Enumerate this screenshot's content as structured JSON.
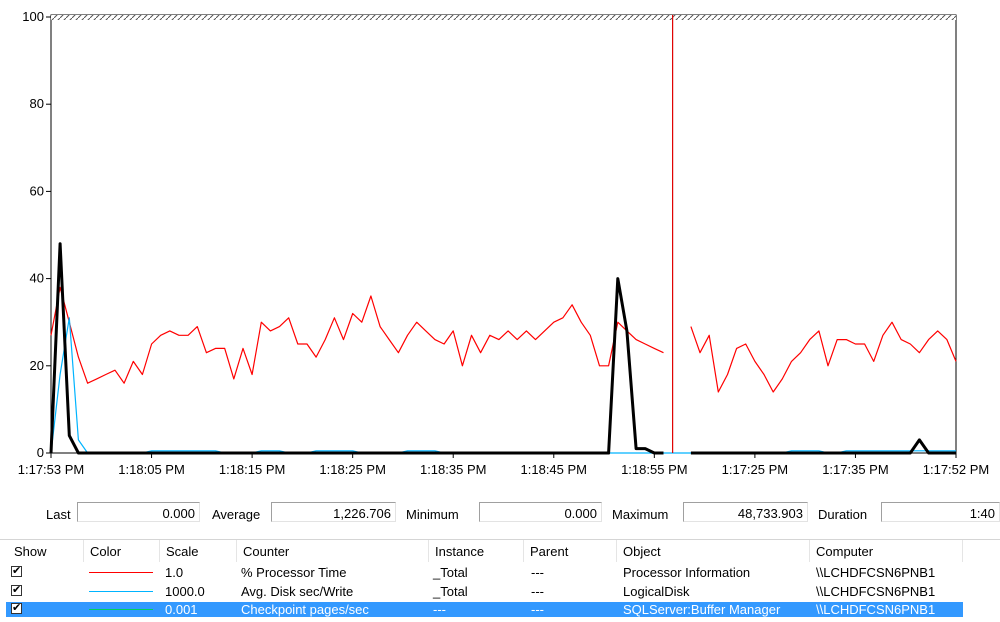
{
  "chart_data": {
    "type": "line",
    "ylim": [
      0,
      100
    ],
    "yticks": [
      "0",
      "20",
      "40",
      "60",
      "80",
      "100"
    ],
    "xticks": [
      "1:17:53 PM",
      "1:18:05 PM",
      "1:18:15 PM",
      "1:18:25 PM",
      "1:18:35 PM",
      "1:18:45 PM",
      "1:18:55 PM",
      "1:17:25 PM",
      "1:17:35 PM",
      "1:17:52 PM"
    ],
    "sample_count": 100,
    "current_sample": 68,
    "colors": {
      "cursor": "#e00000"
    },
    "series": [
      {
        "color": "#ff0000",
        "values": [
          27,
          38,
          30,
          22,
          16,
          17,
          18,
          19,
          16,
          21,
          18,
          25,
          27,
          28,
          27,
          27,
          29,
          23,
          24,
          24,
          17,
          24,
          18,
          30,
          28,
          29,
          31,
          25,
          25,
          22,
          26,
          31,
          26,
          32,
          30,
          36,
          29,
          26,
          23,
          27,
          30,
          28,
          26,
          25,
          28,
          20,
          27,
          23,
          27,
          26,
          28,
          26,
          28,
          26,
          28,
          30,
          31,
          34,
          30,
          27,
          20,
          20,
          30,
          28,
          26,
          25,
          24,
          23,
          null,
          null,
          29,
          23,
          27,
          14,
          18,
          24,
          25,
          21,
          18,
          14,
          17,
          21,
          23,
          26,
          28,
          20,
          26,
          26,
          25,
          25,
          21,
          27,
          30,
          26,
          25,
          23,
          26,
          28,
          26,
          21
        ]
      },
      {
        "color": "#00b4ff",
        "values": [
          0,
          18,
          31,
          3,
          0,
          0,
          0,
          0,
          0,
          0,
          0,
          0.5,
          0.5,
          0.5,
          0.5,
          0.5,
          0.5,
          0.5,
          0.5,
          0,
          0,
          0,
          0,
          0.5,
          0.5,
          0.5,
          0,
          0,
          0,
          0.5,
          0.5,
          0.5,
          0.5,
          0.5,
          0,
          0,
          0,
          0,
          0,
          0.5,
          0.5,
          0.5,
          0.5,
          0,
          0,
          0,
          0,
          0,
          0,
          0,
          0,
          0,
          0,
          0,
          0,
          0,
          0,
          0,
          0,
          0,
          0,
          0,
          0,
          0,
          0,
          0,
          0,
          0,
          0,
          0,
          0,
          0,
          0,
          0,
          0,
          0,
          0,
          0,
          0,
          0,
          0,
          0.5,
          0.5,
          0.5,
          0.5,
          0,
          0,
          0.5,
          0.5,
          0.5,
          0.5,
          0.5,
          0.5,
          0.5,
          0.5,
          0.5,
          0.5,
          0.5,
          0.5,
          0.5
        ]
      },
      {
        "color": "#000000",
        "values": [
          0,
          48,
          4,
          0,
          0,
          0,
          0,
          0,
          0,
          0,
          0,
          0,
          0,
          0,
          0,
          0,
          0,
          0,
          0,
          0,
          0,
          0,
          0,
          0,
          0,
          0,
          0,
          0,
          0,
          0,
          0,
          0,
          0,
          0,
          0,
          0,
          0,
          0,
          0,
          0,
          0,
          0,
          0,
          0,
          0,
          0,
          0,
          0,
          0,
          0,
          0,
          0,
          0,
          0,
          0,
          0,
          0,
          0,
          0,
          0,
          0,
          0,
          40,
          28,
          1,
          1,
          0,
          0,
          null,
          null,
          0,
          0,
          0,
          0,
          0,
          0,
          0,
          0,
          0,
          0,
          0,
          0,
          0,
          0,
          0,
          0,
          0,
          0,
          0,
          0,
          0,
          0,
          0,
          0,
          0,
          3,
          0,
          0,
          0,
          0
        ]
      }
    ]
  },
  "stats": {
    "last_label": "Last",
    "last_value": "0.000",
    "average_label": "Average",
    "average_value": "1,226.706",
    "minimum_label": "Minimum",
    "minimum_value": "0.000",
    "maximum_label": "Maximum",
    "maximum_value": "48,733.903",
    "duration_label": "Duration",
    "duration_value": "1:40"
  },
  "legend": {
    "columns": [
      "Show",
      "Color",
      "Scale",
      "Counter",
      "Instance",
      "Parent",
      "Object",
      "Computer"
    ],
    "check_mark": "✔",
    "rows": [
      {
        "color": "#ff0000",
        "scale": "1.0",
        "counter": "% Processor Time",
        "instance": "_Total",
        "parent": "---",
        "object": "Processor Information",
        "computer": "\\\\LCHDFCSN6PNB1"
      },
      {
        "color": "#00b4ff",
        "scale": "1000.0",
        "counter": "Avg. Disk sec/Write",
        "instance": "_Total",
        "parent": "---",
        "object": "LogicalDisk",
        "computer": "\\\\LCHDFCSN6PNB1"
      },
      {
        "color": "#00d060",
        "scale": "0.001",
        "counter": "Checkpoint pages/sec",
        "instance": "---",
        "parent": "---",
        "object": "SQLServer:Buffer Manager",
        "computer": "\\\\LCHDFCSN6PNB1"
      }
    ]
  }
}
